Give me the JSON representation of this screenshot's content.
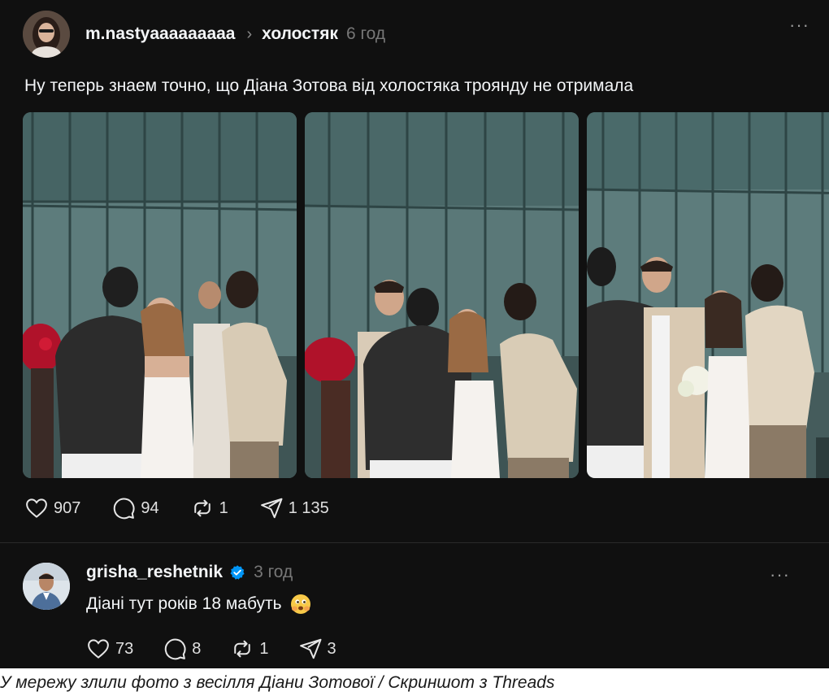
{
  "post": {
    "username": "m.nastyaaaaaaaaa",
    "topic": "холостяк",
    "time": "6 год",
    "more": "···",
    "text": "Ну теперь знаем точно, що Діана Зотова від холостяка троянду не отримала",
    "stats": {
      "likes": "907",
      "comments": "94",
      "reposts": "1",
      "shares": "1 135"
    }
  },
  "reply": {
    "username": "grisha_reshetnik",
    "time": "3 год",
    "more": "···",
    "text": "Діані тут років 18 мабуть",
    "stats": {
      "likes": "73",
      "comments": "8",
      "reposts": "1",
      "shares": "3"
    }
  },
  "caption": "У мережу злили фото з весілля Діани Зотової / Скриншот з Threads",
  "colors": {
    "background": "#101010",
    "text": "#f3f5f7",
    "muted": "#777777",
    "verified": "#0095f6"
  }
}
